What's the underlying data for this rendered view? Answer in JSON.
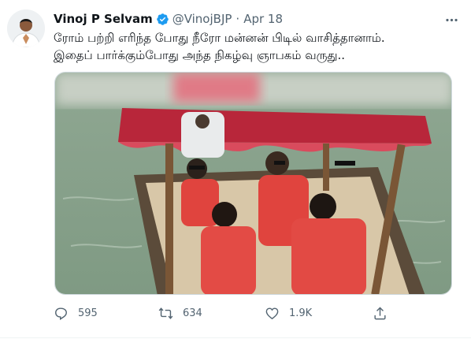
{
  "tweet": {
    "author_name": "Vinoj P Selvam",
    "handle": "@VinojBJP",
    "separator": "·",
    "date": "Apr 18",
    "text_line1": "ரோம் பற்றி எரிந்த போது நீரோ மன்னன் பிடில் வாசித்தானாம்.",
    "text_line2": "இதைப் பார்க்கும்போது அந்த நிகழ்வு ஞாபகம் வருது..",
    "verified": true
  },
  "actions": {
    "reply_count": "595",
    "retweet_count": "634",
    "like_count": "1.9K"
  },
  "icons": {
    "verified": "verified-badge-icon",
    "more": "more-options-icon",
    "reply": "reply-icon",
    "retweet": "retweet-icon",
    "like": "like-heart-icon",
    "share": "share-icon"
  },
  "colors": {
    "accent": "#1d9bf0",
    "muted": "#536471",
    "text": "#0f1419",
    "life_jacket": "#e0443e",
    "water": "#8ea58e"
  }
}
